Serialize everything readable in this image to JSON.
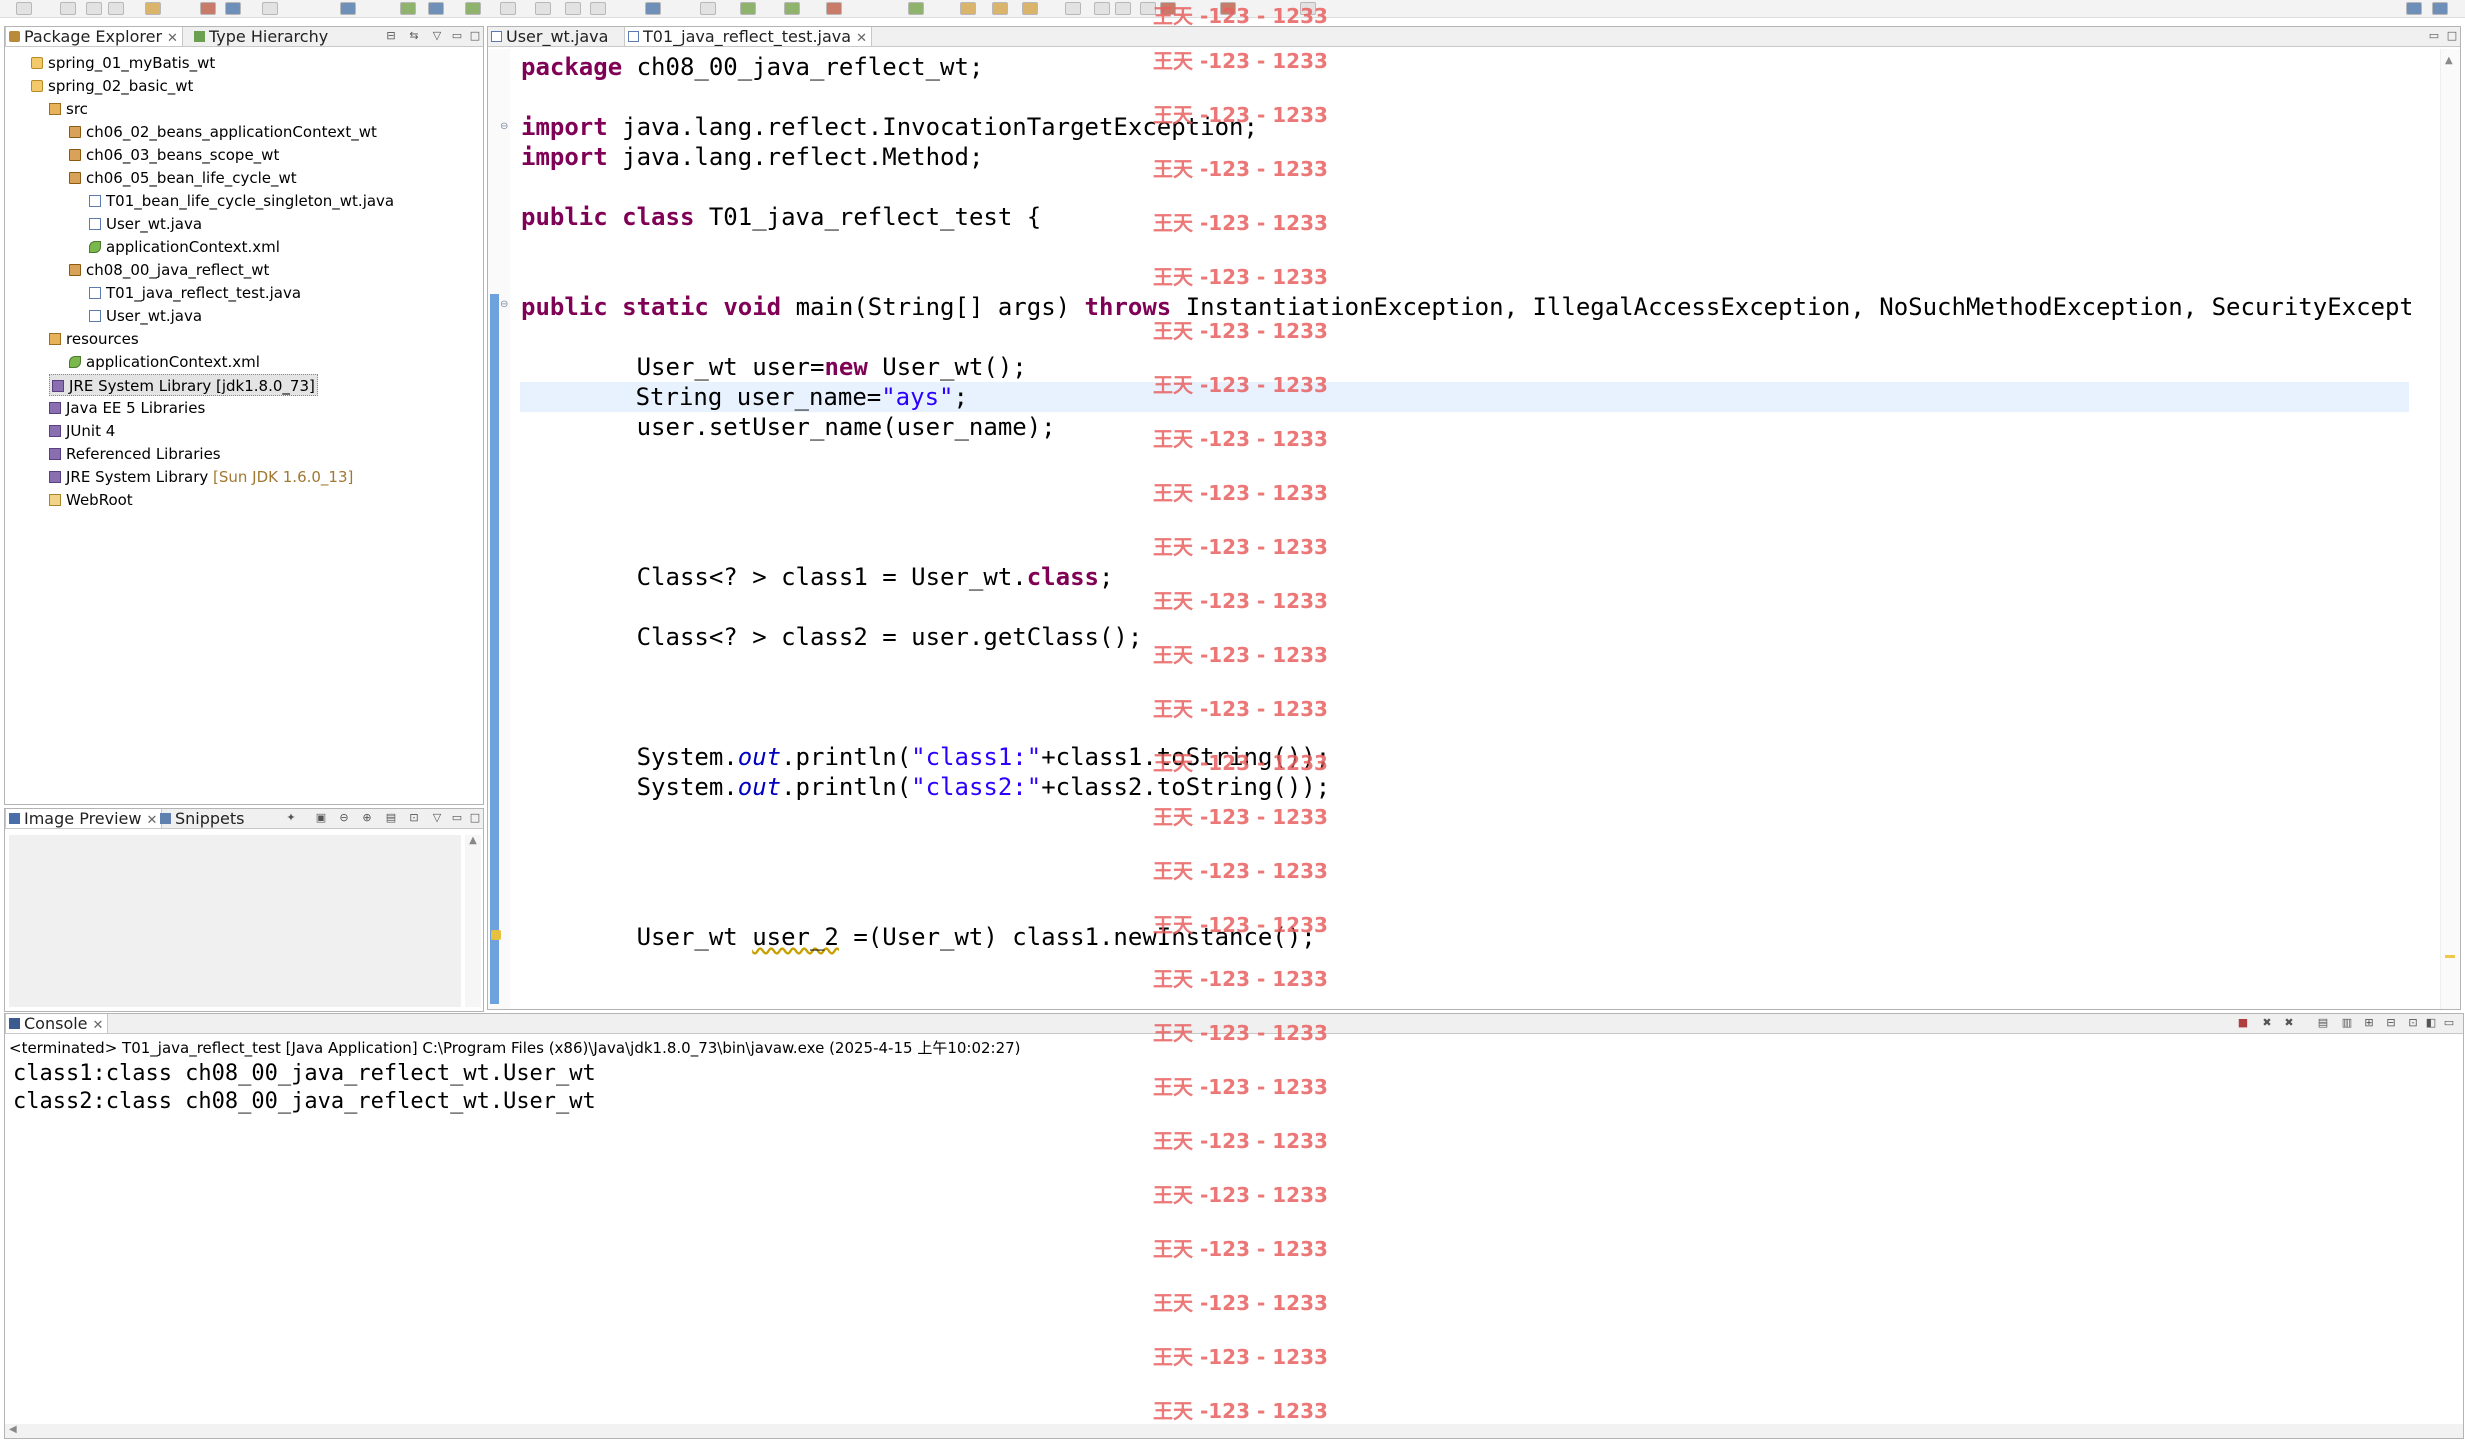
{
  "package_explorer": {
    "tab_label": "Package Explorer",
    "tab2_label": "Type Hierarchy",
    "tree": [
      {
        "label": "spring_01_myBatis_wt",
        "icon": "project-icon"
      },
      {
        "label": "spring_02_basic_wt",
        "icon": "project-icon"
      },
      {
        "label": "src",
        "icon": "source-folder-icon"
      },
      {
        "label": "ch06_02_beans_applicationContext_wt",
        "icon": "package-icon"
      },
      {
        "label": "ch06_03_beans_scope_wt",
        "icon": "package-icon"
      },
      {
        "label": "ch06_05_bean_life_cycle_wt",
        "icon": "package-icon"
      },
      {
        "label": "T01_bean_life_cycle_singleton_wt.java",
        "icon": "java-file-icon"
      },
      {
        "label": "User_wt.java",
        "icon": "java-file-icon"
      },
      {
        "label": "applicationContext.xml",
        "icon": "xml-file-icon"
      },
      {
        "label": "ch08_00_java_reflect_wt",
        "icon": "package-icon"
      },
      {
        "label": "T01_java_reflect_test.java",
        "icon": "java-file-icon"
      },
      {
        "label": "User_wt.java",
        "icon": "java-file-icon"
      },
      {
        "label": "resources",
        "icon": "source-folder-icon"
      },
      {
        "label": "applicationContext.xml",
        "icon": "xml-file-icon"
      },
      {
        "label": "JRE System Library [jdk1.8.0_73]",
        "icon": "library-icon"
      },
      {
        "label": "Java EE 5 Libraries",
        "icon": "library-icon"
      },
      {
        "label": "JUnit 4",
        "icon": "library-icon"
      },
      {
        "label": "Referenced Libraries",
        "icon": "library-icon"
      },
      {
        "label": "JRE System Library",
        "suffix": "[Sun JDK 1.6.0_13]",
        "icon": "library-icon"
      },
      {
        "label": "WebRoot",
        "icon": "folder-icon"
      }
    ]
  },
  "image_preview": {
    "tab_label": "Image Preview",
    "tab2_label": "Snippets"
  },
  "editor": {
    "tabs": [
      {
        "label": "User_wt.java"
      },
      {
        "label": "T01_java_reflect_test.java"
      }
    ],
    "lines": {
      "l01": "package ch08_00_java_reflect_wt;",
      "l03a": "import java.lang.reflect.InvocationTargetException;",
      "l03b": "import java.lang.reflect.Method;",
      "l05": "public class T01_java_reflect_test {",
      "l08": "public static void main(String[] args) throws InstantiationException, IllegalAccessException, NoSuchMethodException, SecurityException,",
      "l10": "User_wt user=new User_wt();",
      "l11": "String user_name=\"ays\";",
      "l12": "user.setUser_name(user_name);",
      "l17": "Class<? > class1 = User_wt.class;",
      "l19": "Class<? > class2 = user.getClass();",
      "l23": "System.out.println(\"class1:\"+class1.toString());",
      "l24": "System.out.println(\"class2:\"+class2.toString());",
      "l29": "User_wt user_2 =(User_wt) class1.newInstance();"
    }
  },
  "console": {
    "tab_label": "Console",
    "status": "<terminated> T01_java_reflect_test [Java Application] C:\\Program Files (x86)\\Java\\jdk1.8.0_73\\bin\\javaw.exe (2025-4-15 上午10:02:27)",
    "output": [
      "class1:class ch08_00_java_reflect_wt.User_wt",
      "class2:class ch08_00_java_reflect_wt.User_wt"
    ]
  },
  "watermark": {
    "text": "王天 -123 - 1233"
  }
}
